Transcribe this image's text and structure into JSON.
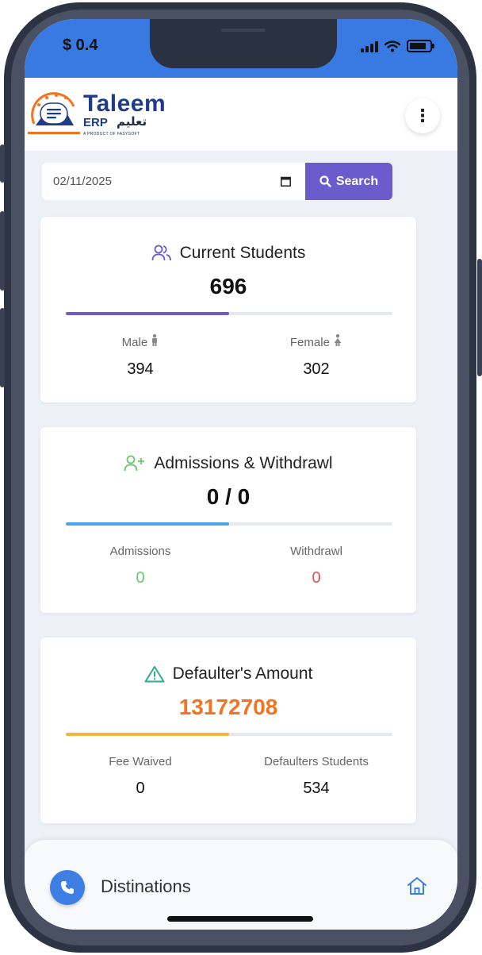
{
  "status": {
    "time": "$ 0.4"
  },
  "header": {
    "logo_title": "Taleem",
    "logo_erp": "ERP",
    "logo_arabic": "تعليم",
    "logo_sub": "A PRODUCT OF FASYSOFT",
    "menu_glyph": "⋮"
  },
  "search": {
    "date_value": "02/11/2025",
    "button_label": "Search"
  },
  "cards": {
    "current_students": {
      "title": "Current Students",
      "value": "696",
      "progress": 0.5,
      "left_label": "Male",
      "left_value": "394",
      "right_label": "Female",
      "right_value": "302"
    },
    "admissions": {
      "title": "Admissions & Withdrawl",
      "value": "0 / 0",
      "progress": 0.5,
      "left_label": "Admissions",
      "left_value": "0",
      "right_label": "Withdrawl",
      "right_value": "0"
    },
    "defaulters": {
      "title": "Defaulter's Amount",
      "value": "13172708",
      "progress": 0.5,
      "left_label": "Fee Waived",
      "left_value": "0",
      "right_label": "Defaulters Students",
      "right_value": "534"
    }
  },
  "bottom": {
    "label": "Distinations"
  },
  "colors": {
    "status_bar": "#3979e2",
    "primary": "#6b5bcc",
    "students_progress": "#6b5bcc",
    "admissions_progress": "#4da3f0",
    "defaulters_progress": "#f5b53d",
    "defaulters_value": "#f5731f",
    "admissions_value": "#6cc66c",
    "withdrawl_value": "#e0524f"
  },
  "icons": {
    "students": "users-icon",
    "admissions": "user-plus-icon",
    "defaulters": "alert-triangle-icon",
    "calendar": "calendar-icon",
    "search": "search-icon",
    "call": "phone-icon",
    "home": "home-icon"
  }
}
